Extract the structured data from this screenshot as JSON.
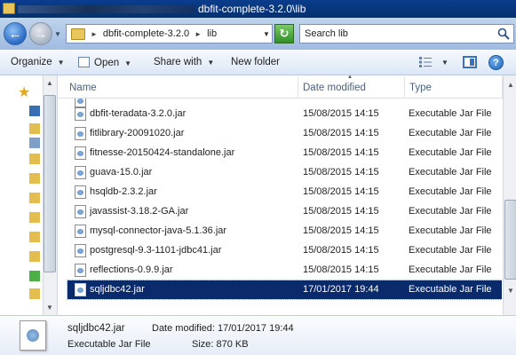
{
  "window": {
    "title": "dbfit-complete-3.2.0\\lib"
  },
  "address": {
    "crumbs": [
      "dbfit-complete-3.2.0",
      "lib"
    ],
    "search_placeholder": "Search lib"
  },
  "toolbar": {
    "organize": "Organize",
    "open": "Open",
    "share_with": "Share with",
    "new_folder": "New folder"
  },
  "columns": {
    "name": "Name",
    "date": "Date modified",
    "type": "Type"
  },
  "files": [
    {
      "name": "dbfit-teradata-3.2.0.jar",
      "date": "15/08/2015 14:15",
      "type": "Executable Jar File"
    },
    {
      "name": "fitlibrary-20091020.jar",
      "date": "15/08/2015 14:15",
      "type": "Executable Jar File"
    },
    {
      "name": "fitnesse-20150424-standalone.jar",
      "date": "15/08/2015 14:15",
      "type": "Executable Jar File"
    },
    {
      "name": "guava-15.0.jar",
      "date": "15/08/2015 14:15",
      "type": "Executable Jar File"
    },
    {
      "name": "hsqldb-2.3.2.jar",
      "date": "15/08/2015 14:15",
      "type": "Executable Jar File"
    },
    {
      "name": "javassist-3.18.2-GA.jar",
      "date": "15/08/2015 14:15",
      "type": "Executable Jar File"
    },
    {
      "name": "mysql-connector-java-5.1.36.jar",
      "date": "15/08/2015 14:15",
      "type": "Executable Jar File"
    },
    {
      "name": "postgresql-9.3-1101-jdbc41.jar",
      "date": "15/08/2015 14:15",
      "type": "Executable Jar File"
    },
    {
      "name": "reflections-0.9.9.jar",
      "date": "15/08/2015 14:15",
      "type": "Executable Jar File"
    },
    {
      "name": "sqljdbc42.jar",
      "date": "17/01/2017 19:44",
      "type": "Executable Jar File",
      "selected": true
    }
  ],
  "details": {
    "name": "sqljdbc42.jar",
    "type": "Executable Jar File",
    "modified_label": "Date modified: 17/01/2017 19:44",
    "size_label": "Size: 870 KB"
  },
  "colors": {
    "selection": "#0b2a6b",
    "titlebar": "#0a3d8c"
  }
}
